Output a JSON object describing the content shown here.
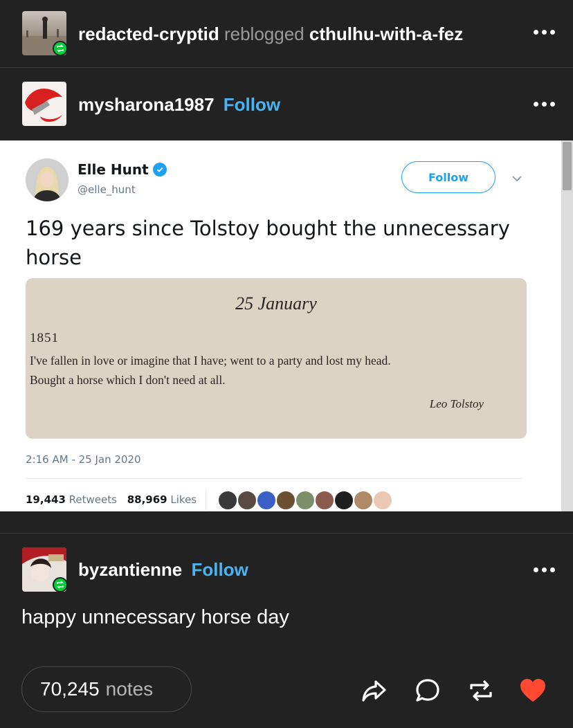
{
  "header": {
    "reblogger": "redacted-cryptid",
    "reblogged_word": "reblogged",
    "reblogged_from": "cthulhu-with-a-fez"
  },
  "op": {
    "username": "mysharona1987",
    "follow_label": "Follow"
  },
  "tweet": {
    "name": "Elle Hunt",
    "handle": "@elle_hunt",
    "follow_label": "Follow",
    "text": "169 years since Tolstoy bought the unnecessary horse",
    "book_page": {
      "date": "25 January",
      "year": "1851",
      "line1": "I've fallen in love or imagine that I have; went to a party and lost my head.",
      "line2": "Bought a horse which I don't need at all.",
      "signature": "Leo Tolstoy"
    },
    "timestamp": "2:16 AM - 25 Jan 2020",
    "retweets": "19,443",
    "retweets_label": "Retweets",
    "likes": "88,969",
    "likes_label": "Likes",
    "colors": {
      "accent": "#1da1f2",
      "text": "#14171a",
      "muted": "#657786"
    }
  },
  "reply": {
    "username": "byzantienne",
    "follow_label": "Follow",
    "text": "happy unnecessary horse day"
  },
  "footer": {
    "notes_count": "70,245",
    "notes_label": "notes",
    "icons": [
      "share-icon",
      "reply-icon",
      "reblog-icon",
      "like-icon"
    ]
  },
  "colors": {
    "background": "#222222",
    "follow": "#4ab4f1",
    "reblog_badge": "#00cf35",
    "like": "#ff4930"
  }
}
